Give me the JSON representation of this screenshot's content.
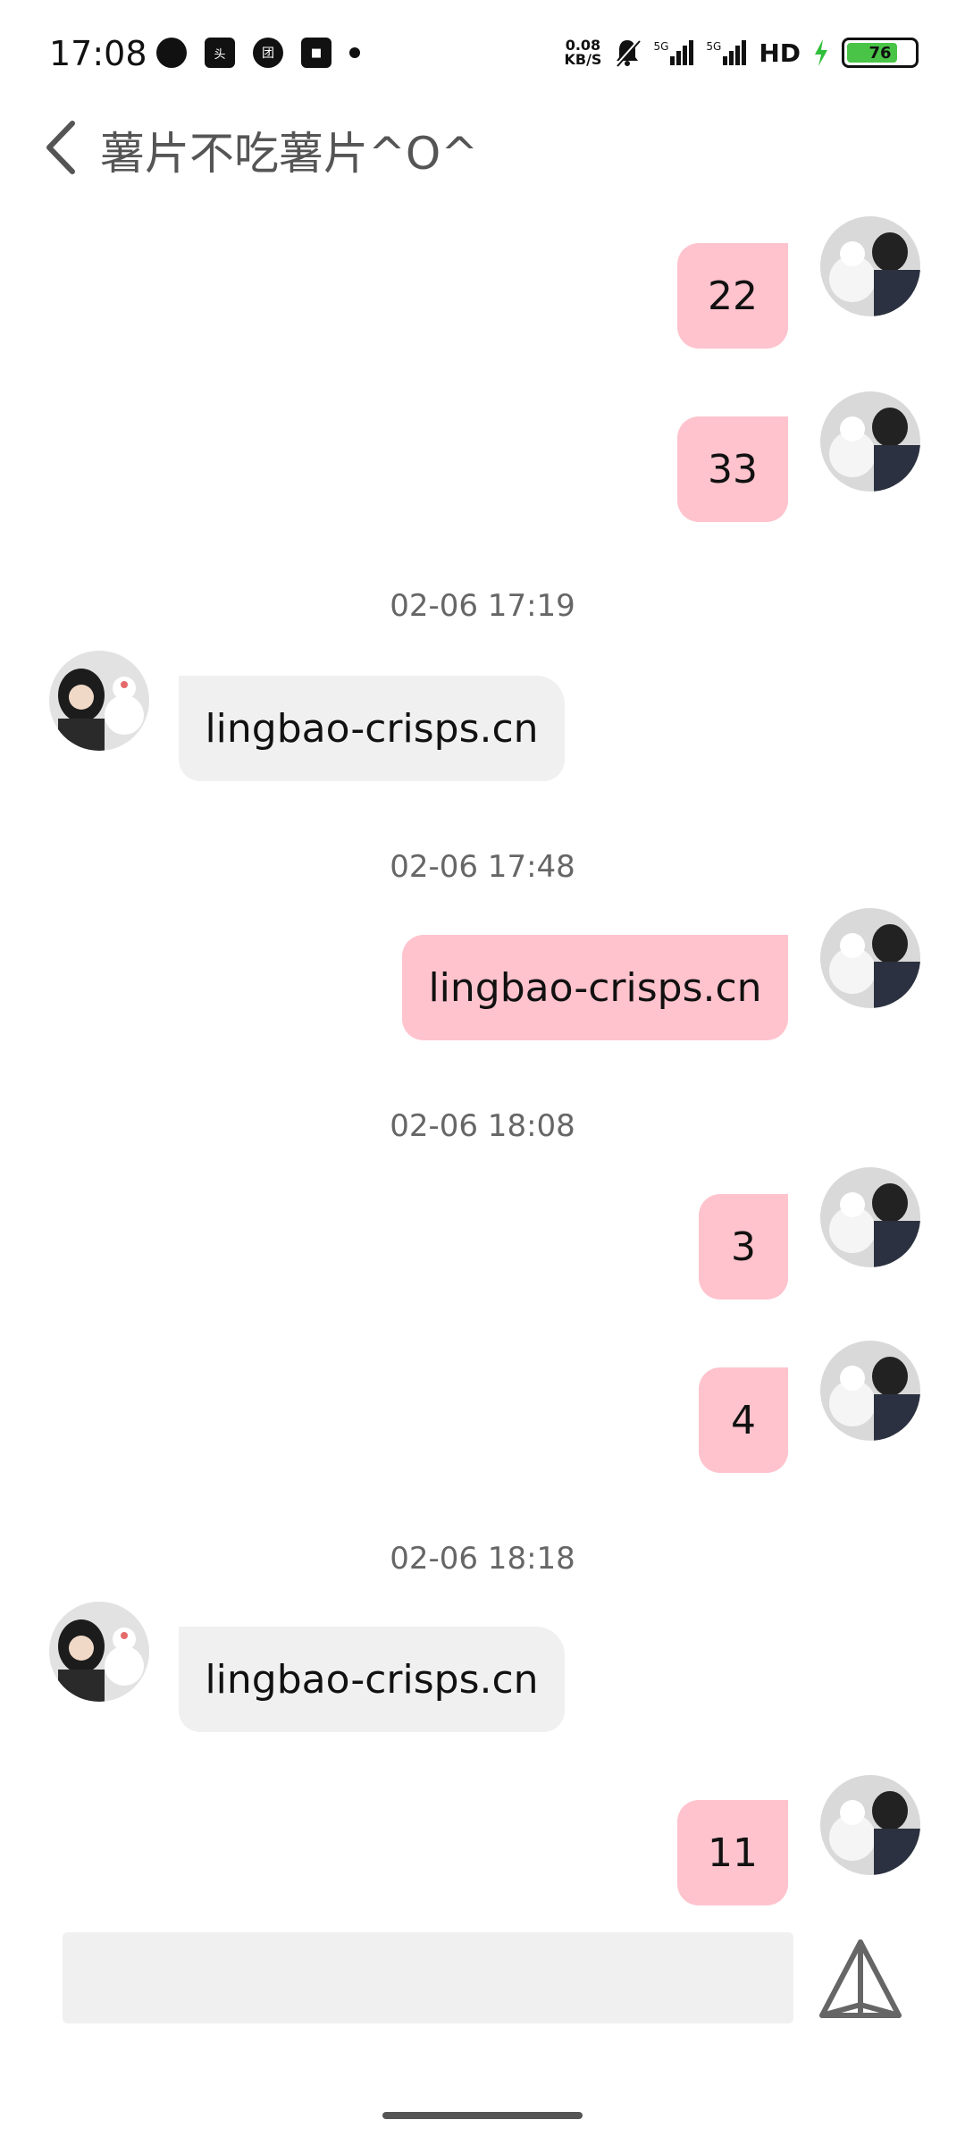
{
  "status_bar": {
    "time": "17:08",
    "net_speed_value": "0.08",
    "net_speed_unit": "KB/S",
    "signal_1": "5G",
    "signal_2": "5G",
    "hd_label": "HD",
    "battery": "76",
    "battery_level": 0.76,
    "icons": [
      "chat-bubble-icon",
      "toutiao-icon",
      "tuan-icon",
      "app-icon",
      "notification-dot-icon",
      "mute-bell-icon",
      "signal-icon",
      "charging-icon",
      "battery-icon"
    ]
  },
  "header": {
    "back_icon": "chevron-left-icon",
    "title": "薯片不吃薯片^O^"
  },
  "messages": [
    {
      "side": "me",
      "text": "22"
    },
    {
      "side": "me",
      "text": "33"
    },
    {
      "timestamp": "02-06 17:19"
    },
    {
      "side": "other",
      "text": "lingbao-crisps.cn"
    },
    {
      "timestamp": "02-06 17:48"
    },
    {
      "side": "me",
      "text": "lingbao-crisps.cn"
    },
    {
      "timestamp": "02-06 18:08"
    },
    {
      "side": "me",
      "text": "3"
    },
    {
      "side": "me",
      "text": "4"
    },
    {
      "timestamp": "02-06 18:18"
    },
    {
      "side": "other",
      "text": "lingbao-crisps.cn"
    },
    {
      "side": "me",
      "text": "11"
    }
  ],
  "input": {
    "placeholder": "",
    "send_icon": "send-icon"
  },
  "colors": {
    "my_bubble": "#ffc3cd",
    "other_bubble": "#f0f0f0",
    "timestamp_text": "#666666"
  }
}
